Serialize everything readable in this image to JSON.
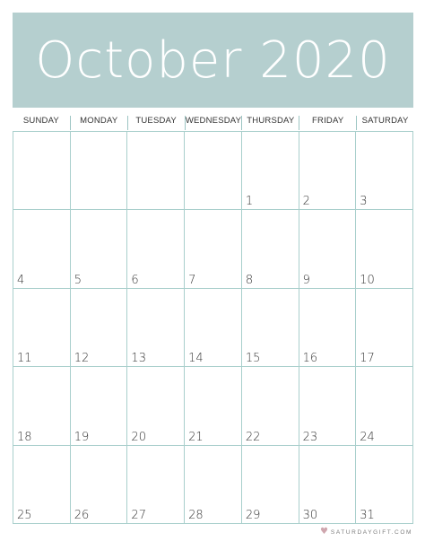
{
  "header": {
    "title": "October 2020"
  },
  "weekdays": [
    "SUNDAY",
    "MONDAY",
    "TUESDAY",
    "WEDNESDAY",
    "THURSDAY",
    "FRIDAY",
    "SATURDAY"
  ],
  "weeks": [
    [
      "",
      "",
      "",
      "",
      "1",
      "2",
      "3"
    ],
    [
      "4",
      "5",
      "6",
      "7",
      "8",
      "9",
      "10"
    ],
    [
      "11",
      "12",
      "13",
      "14",
      "15",
      "16",
      "17"
    ],
    [
      "18",
      "19",
      "20",
      "21",
      "22",
      "23",
      "24"
    ],
    [
      "25",
      "26",
      "27",
      "28",
      "29",
      "30",
      "31"
    ]
  ],
  "footer": {
    "brand": "SATURDAYGIFT.COM",
    "icon": "heart-icon"
  },
  "colors": {
    "banner": "#b5cfcf",
    "grid_lines": "#a9cfcc",
    "text": "#333333"
  }
}
